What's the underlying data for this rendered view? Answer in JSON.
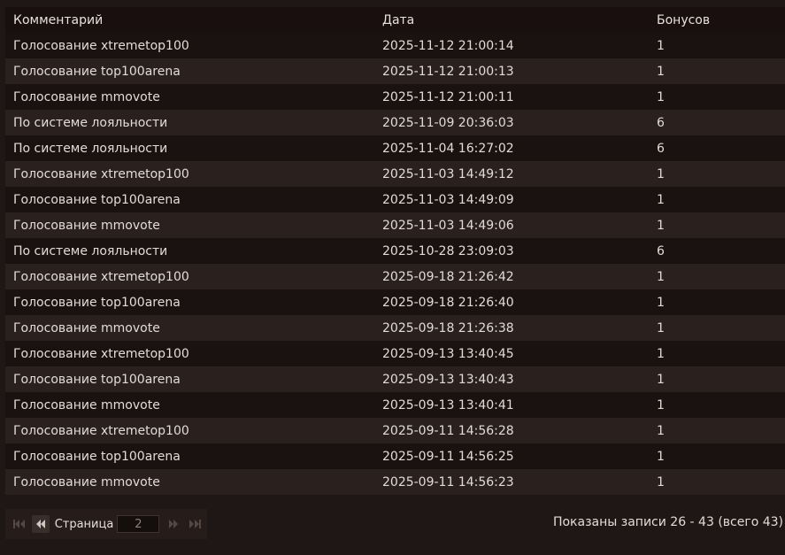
{
  "columns": {
    "comment": "Комментарий",
    "date": "Дата",
    "bonus": "Бонусов"
  },
  "rows": [
    {
      "comment": "Голосование xtremetop100",
      "date": "2025-11-12 21:00:14",
      "bonus": "1"
    },
    {
      "comment": "Голосование top100arena",
      "date": "2025-11-12 21:00:13",
      "bonus": "1"
    },
    {
      "comment": "Голосование mmovote",
      "date": "2025-11-12 21:00:11",
      "bonus": "1"
    },
    {
      "comment": "По системе лояльности",
      "date": "2025-11-09 20:36:03",
      "bonus": "6"
    },
    {
      "comment": "По системе лояльности",
      "date": "2025-11-04 16:27:02",
      "bonus": "6"
    },
    {
      "comment": "Голосование xtremetop100",
      "date": "2025-11-03 14:49:12",
      "bonus": "1"
    },
    {
      "comment": "Голосование top100arena",
      "date": "2025-11-03 14:49:09",
      "bonus": "1"
    },
    {
      "comment": "Голосование mmovote",
      "date": "2025-11-03 14:49:06",
      "bonus": "1"
    },
    {
      "comment": "По системе лояльности",
      "date": "2025-10-28 23:09:03",
      "bonus": "6"
    },
    {
      "comment": "Голосование xtremetop100",
      "date": "2025-09-18 21:26:42",
      "bonus": "1"
    },
    {
      "comment": "Голосование top100arena",
      "date": "2025-09-18 21:26:40",
      "bonus": "1"
    },
    {
      "comment": "Голосование mmovote",
      "date": "2025-09-18 21:26:38",
      "bonus": "1"
    },
    {
      "comment": "Голосование xtremetop100",
      "date": "2025-09-13 13:40:45",
      "bonus": "1"
    },
    {
      "comment": "Голосование top100arena",
      "date": "2025-09-13 13:40:43",
      "bonus": "1"
    },
    {
      "comment": "Голосование mmovote",
      "date": "2025-09-13 13:40:41",
      "bonus": "1"
    },
    {
      "comment": "Голосование xtremetop100",
      "date": "2025-09-11 14:56:28",
      "bonus": "1"
    },
    {
      "comment": "Голосование top100arena",
      "date": "2025-09-11 14:56:25",
      "bonus": "1"
    },
    {
      "comment": "Голосование mmovote",
      "date": "2025-09-11 14:56:23",
      "bonus": "1"
    }
  ],
  "pager": {
    "page_label": "Страница",
    "page_value": "2",
    "first_icon": "first-page-icon",
    "prev_icon": "prev-page-icon",
    "next_icon": "next-page-icon",
    "last_icon": "last-page-icon",
    "records_info": "Показаны записи 26 - 43 (всего 43)"
  },
  "colors": {
    "background": "#1f1715",
    "header_bg": "#180f0e",
    "row_dark": "#1a1210",
    "row_light": "#2a201d",
    "text": "#e2dbd6"
  }
}
